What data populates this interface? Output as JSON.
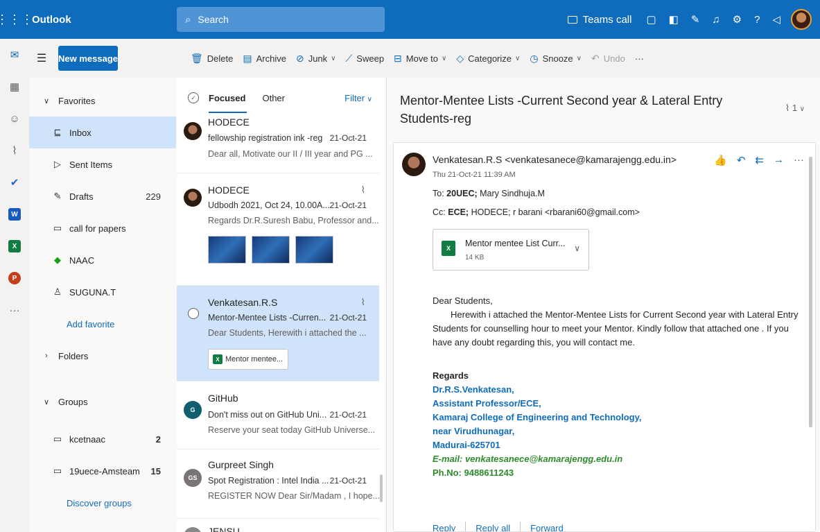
{
  "app": {
    "title": "Outlook"
  },
  "search": {
    "placeholder": "Search"
  },
  "top_actions": {
    "teams_call": "Teams call"
  },
  "command_bar": {
    "new_message": "New message",
    "delete": "Delete",
    "archive": "Archive",
    "junk": "Junk",
    "sweep": "Sweep",
    "move_to": "Move to",
    "categorize": "Categorize",
    "snooze": "Snooze",
    "undo": "Undo",
    "more": "···"
  },
  "folders": {
    "favorites": "Favorites",
    "inbox": "Inbox",
    "sent_items": "Sent Items",
    "drafts": "Drafts",
    "drafts_count": "229",
    "call_for_papers": "call for papers",
    "naac": "NAAC",
    "suguna": "SUGUNA.T",
    "add_favorite": "Add favorite",
    "folders_label": "Folders",
    "groups": "Groups",
    "group_items": [
      {
        "name": "kcetnaac",
        "count": "2"
      },
      {
        "name": "19uece-Amsteam",
        "count": "15"
      }
    ],
    "discover_groups": "Discover groups"
  },
  "message_list": {
    "tab_focused": "Focused",
    "tab_other": "Other",
    "filter": "Filter",
    "messages": [
      {
        "sender": "HODECE",
        "subject": "fellowship registration ink -reg",
        "date": "21-Oct-21",
        "preview": "Dear all, Motivate our II / III year and PG ..."
      },
      {
        "sender": "HODECE",
        "subject": "Udbodh 2021, Oct 24, 10.00A...",
        "date": "21-Oct-21",
        "preview": "Regards Dr.R.Suresh Babu, Professor and..."
      },
      {
        "sender": "Venkatesan.R.S",
        "subject": "Mentor-Mentee Lists -Curren...",
        "date": "21-Oct-21",
        "preview": "Dear Students, Herewith i attached the ...",
        "attachment": "Mentor mentee..."
      },
      {
        "sender": "GitHub",
        "initials": "G",
        "subject": "Don't miss out on GitHub Uni...",
        "date": "21-Oct-21",
        "preview": "Reserve your seat today GitHub Universe..."
      },
      {
        "sender": "Gurpreet Singh",
        "initials": "GS",
        "subject": "Spot Registration : Intel India ...",
        "date": "21-Oct-21",
        "preview": "REGISTER NOW Dear Sir/Madam , I hope..."
      },
      {
        "sender": "JENSU"
      }
    ]
  },
  "reading": {
    "subject": "Mentor-Mentee Lists -Current Second year & Lateral Entry Students-reg",
    "attach_count": "1",
    "from": "Venkatesan.R.S <venkatesanece@kamarajengg.edu.in>",
    "when": "Thu 21-Oct-21 11:39 AM",
    "to_label": "To:",
    "to_bold": "20UEC;",
    "to_rest": "Mary Sindhuja.M",
    "cc_label": "Cc:",
    "cc_bold": "ECE;",
    "cc_rest": "HODECE; r barani <rbarani60@gmail.com>",
    "attachment": {
      "name": "Mentor mentee List Curr...",
      "size": "14 KB",
      "badge": "X"
    },
    "greeting": "Dear Students,",
    "body": "Herewith i attached the Mentor-Mentee Lists for Current Second year with Lateral Entry Students for counselling hour to meet your Mentor. Kindly follow that attached one . If you have any doubt regarding this, you will contact me.",
    "signature": {
      "regards": "Regards",
      "name": "Dr.R.S.Venkatesan,",
      "title": "Assistant Professor/ECE,",
      "college": "Kamaraj College of Engineering and Technology,",
      "place": "near Virudhunagar,",
      "city": "Madurai-625701",
      "email": "E-mail: venkatesanece@kamarajengg.edu.in",
      "phone": "Ph.No: 9488611243"
    },
    "reply": "Reply",
    "reply_all": "Reply all",
    "forward": "Forward"
  },
  "colors": {
    "brand": "#0f6cbd",
    "selected": "#cfe4fa",
    "excel": "#107c41",
    "signature_green": "#2e8b2e"
  }
}
